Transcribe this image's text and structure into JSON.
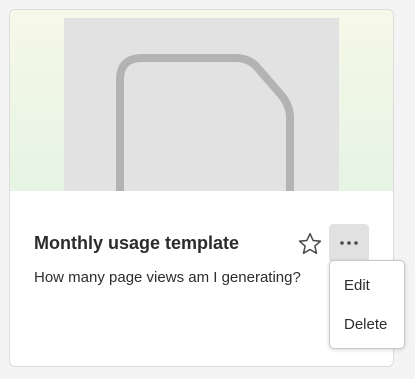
{
  "card": {
    "title": "Monthly usage template",
    "description": "How many page views am I generating?",
    "thumbnail_icon": "document-icon",
    "favorite_icon": "star-outline-icon",
    "more_icon": "ellipsis-icon"
  },
  "menu": {
    "items": [
      {
        "label": "Edit"
      },
      {
        "label": "Delete"
      }
    ]
  },
  "colors": {
    "preview_gradient_top": "#f7f8ea",
    "preview_gradient_bottom": "#e5f4e4",
    "thumbnail_bg": "#e2e2e2",
    "icon_stroke": "#b3b3b3",
    "more_button_bg": "#e1e1e1",
    "text": "#2c2c2c"
  }
}
